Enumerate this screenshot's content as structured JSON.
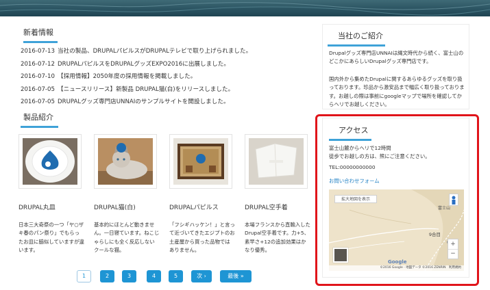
{
  "news": {
    "title": "新着情報",
    "items": [
      {
        "date": "2016-07-13",
        "text": "当社の製品、DRUPALパピルスがDRUPALテレビで取り上げられました。"
      },
      {
        "date": "2016-07-12",
        "text": "DRUPALパピルスをDRUPALグッズEXPO2016に出展しました。"
      },
      {
        "date": "2016-07-10",
        "text": "【採用情報】2050年度の採用情報を掲載しました。"
      },
      {
        "date": "2016-07-05",
        "text": "【ニュースリリース】新製品 DRUPAL猫(白)をリリースしました。"
      },
      {
        "date": "2016-07-05",
        "text": "DRUPALグッズ専門店UNNAIのサンプルサイトを開設しました。"
      }
    ]
  },
  "products": {
    "title": "製品紹介",
    "items": [
      {
        "name": "DRUPAL丸皿",
        "desc": "日本三大奇祭の一つ「ヤ○ザキ春のパン祭り」でもらったお皿に脇似していますが違います。"
      },
      {
        "name": "DRUPAL猫(白)",
        "desc": "基本的にほとんど動きません。一日寝ています。ねこじゃらしにも全く反応しないクールな猫。"
      },
      {
        "name": "DRUPALパピルス",
        "desc": "「フシギハッケン！」と言って近づいてきたエジプトのお土産屋から買った品物ではありません。"
      },
      {
        "name": "DRUPAL空手着",
        "desc": "本場フランスから直輸入したDrupal空手着です。力+5、素早さ+12の追加効果はかなり優秀。"
      }
    ]
  },
  "pager": {
    "pages": [
      "1",
      "2",
      "3",
      "4",
      "5"
    ],
    "next": "次 ›",
    "last": "最後 »"
  },
  "about": {
    "title": "当社のご紹介",
    "p1": "Drupalグッズ専門店UNNAIは縄文時代から続く、富士山のどこかにあらしいDrupalグッズ専門店です。",
    "p2": "国内外から集めたDrupalに関するあらゆるグッズを取り扱っております。珍品から激安品まで幅広く取り扱っております。お越しの際は事前にgoogleマップで場所を確認してからヘリでお越しください。"
  },
  "access": {
    "title": "アクセス",
    "line1": "富士山麓からヘリで12時間",
    "line2": "徒歩でお越しの方は、熊にご注意ください。",
    "tel": "TEL:00000000000",
    "contact_link": "お問い合わせフォーム",
    "map_enlarge": "拡大地図を表示",
    "map_label_1": "9合目",
    "map_label_2": "富士山",
    "map_copyright": "©2016 Google · 地図データ ©2016 ZENRIN　利用規約",
    "map_logo": "Google"
  },
  "colors": {
    "accent": "#3ea2d8",
    "pager": "#1e95d4",
    "highlight": "#e0141a"
  }
}
